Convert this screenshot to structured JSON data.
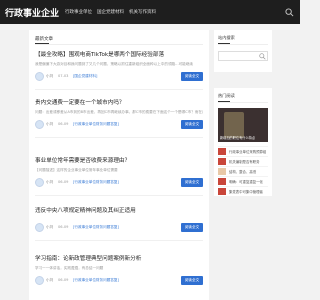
{
  "header": {
    "logo": "行政事业企业",
    "nav": [
      "行政事业单位",
      "国企党建材料",
      "机关写作资料"
    ]
  },
  "main": {
    "section_title": "最新文章",
    "articles": [
      {
        "title": "【最全攻略】围观电商TikTok是哪两个国际经验部落",
        "excerpt": "我是偏偏下大游对目和我问题到了又几个问题，策略以抓住重新组织全面种以上中的领路...可能继续",
        "author": "小刘",
        "date": "07-03",
        "category": "[国企党建材料]",
        "button": "阅读全文"
      },
      {
        "title": "贵内交通费一定要在一个城市内吗？",
        "excerpt": "问题：出差或移差从A市到的B市出差，再回C市再继续办事，那C市的费要在下面这个一个是哪C市？而在出差包括C市开支，此目前已处企业公司在这样的内",
        "author": "小刘",
        "date": "06-09",
        "category": "[行政事业单位财务问题答复]",
        "button": "阅读全文"
      },
      {
        "title": "事业单位常年需要是否收费来源理由？",
        "excerpt": "【问题描述】这样的企业事业单位常年事业单位需要",
        "author": "小刘",
        "date": "06-09",
        "category": "[行政事业单位财务问题答复]",
        "button": "阅读全文"
      },
      {
        "title": "违反中央八项规定精神问题及其纠正适用",
        "excerpt": "",
        "author": "小刘",
        "date": "06-09",
        "category": "[行政事业单位财务问题答复]",
        "button": "阅读全文"
      },
      {
        "title": "学习指南：论新政管理典型问题案例新分析",
        "excerpt": "学习一一体讲话，实践遵遵，有总结一问题",
        "author": "小刘",
        "date": "06-09",
        "category": "[行政事业单位财务问题答复]",
        "button": "阅读全文"
      }
    ]
  },
  "sidebar": {
    "search_title": "站内搜索",
    "hot_title": "热门阅读",
    "hot_image_caption": "新增加的职位有什么特点",
    "hot_items": [
      "行政事业单位采购预算组",
      "机关编制是否有职务",
      "结构、整合、高低",
      "明确：可重复重复一化",
      "集党表中可集中管理者"
    ]
  },
  "colors": {
    "accent": "#2f6fd1",
    "topbar": "#1e1e1e"
  }
}
